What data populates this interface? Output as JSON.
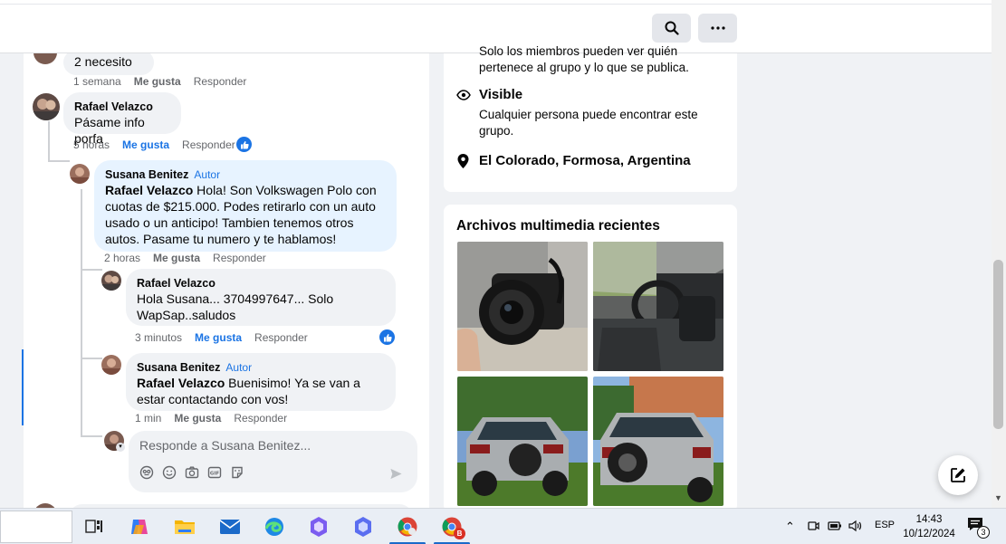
{
  "header": {
    "search_icon": "search-icon",
    "more_icon": "more-dots-icon"
  },
  "comments": [
    {
      "author": "",
      "text": "2 necesito",
      "time": "1 semana",
      "like": "Me gusta",
      "reply": "Responder"
    },
    {
      "author": "Rafael Velazco",
      "text": "Pásame info porfa",
      "time": "5 horas",
      "like": "Me gusta",
      "reply": "Responder"
    },
    {
      "author": "Susana Benitez",
      "badge": "Autor",
      "mention": "Rafael Velazco",
      "text": " Hola! Son Volkswagen Polo con cuotas de $215.000. Podes retirarlo con un auto usado o un anticipo! Tambien tenemos otros autos. Pasame tu numero y te hablamos!",
      "time": "2 horas",
      "like": "Me gusta",
      "reply": "Responder"
    },
    {
      "author": "Rafael Velazco",
      "text": "Hola Susana... 3704997647... Solo WapSap..saludos",
      "time": "3 minutos",
      "like": "Me gusta",
      "reply": "Responder"
    },
    {
      "author": "Susana Benitez",
      "badge": "Autor",
      "mention": "Rafael Velazco",
      "text": " Buenisimo! Ya se van a estar contactando con vos!",
      "time": "1 min",
      "like": "Me gusta",
      "reply": "Responder"
    }
  ],
  "reply_box": {
    "placeholder": "Responde a Susana Benitez..."
  },
  "about": {
    "private_text": "Solo los miembros pueden ver quién pertenece al grupo y lo que se publica.",
    "visible_title": "Visible",
    "visible_text": "Cualquier persona puede encontrar este grupo.",
    "location": "El Colorado, Formosa, Argentina"
  },
  "media": {
    "title": "Archivos multimedia recientes"
  },
  "taskbar": {
    "language": "ESP",
    "time": "14:43",
    "date": "10/12/2024",
    "notifications": "3",
    "chrome_badge": "B"
  },
  "colors": {
    "accent": "#1b74e4",
    "bubble": "#f0f2f5",
    "author_bubble": "#e7f3ff"
  }
}
